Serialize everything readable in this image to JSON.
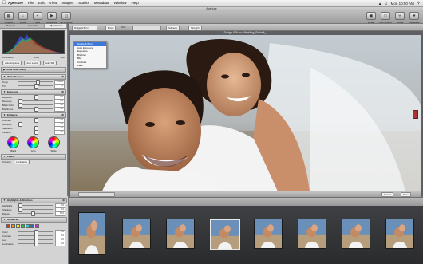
{
  "menubar": {
    "app": "Aperture",
    "items": [
      "File",
      "Edit",
      "View",
      "Images",
      "Stacks",
      "Metadata",
      "Window",
      "Help"
    ],
    "clock": "Mon 10:50 AM"
  },
  "window": {
    "title": "Aperture"
  },
  "toolbar": {
    "left": [
      {
        "label": "Projects",
        "icon": "projects-icon"
      },
      {
        "label": "Import",
        "icon": "import-icon"
      },
      {
        "label": "New",
        "icon": "new-icon"
      },
      {
        "label": "Slideshow",
        "icon": "slideshow-icon"
      },
      {
        "label": "All Projects",
        "icon": "all-projects-icon"
      }
    ],
    "right": [
      {
        "label": "Viewer",
        "icon": "viewer-icon"
      },
      {
        "label": "Full Screen",
        "icon": "fullscreen-icon"
      },
      {
        "label": "Loupe",
        "icon": "loupe-icon"
      },
      {
        "label": "Keywords",
        "icon": "keywords-icon"
      }
    ]
  },
  "inspector": {
    "tabs": [
      "Projects",
      "Metadata",
      "Adjustments"
    ],
    "histogram_labels": [
      "Luminance",
      "RGB",
      "Auto"
    ],
    "preset_buttons": [
      "Auto Exposure",
      "Auto Levels",
      "Auto WB"
    ],
    "sections": {
      "raw": "RAW Fine Tuning",
      "white_balance": "White Balance",
      "exposure": "Exposure",
      "enhance": "Enhance",
      "levels": "Levels",
      "highlights": "Highlights & Shadows",
      "advanced": "Advanced"
    },
    "sliders": [
      {
        "label": "Temp",
        "value": "5748 K",
        "pos": 0.55
      },
      {
        "label": "Tint",
        "value": "0",
        "pos": 0.5
      },
      {
        "label": "Exposure",
        "value": "0.0",
        "pos": 0.5
      },
      {
        "label": "Recovery",
        "value": "0.0",
        "pos": 0.05
      },
      {
        "label": "Black Point",
        "value": "0.0",
        "pos": 0.05
      },
      {
        "label": "Brightness",
        "value": "0.0",
        "pos": 0.5
      },
      {
        "label": "Contrast",
        "value": "0.0",
        "pos": 0.5
      },
      {
        "label": "Definition",
        "value": "0.0",
        "pos": 0.05
      },
      {
        "label": "Saturation",
        "value": "1.0",
        "pos": 0.5
      },
      {
        "label": "Vibrancy",
        "value": "0.0",
        "pos": 0.5
      }
    ],
    "wheels": [
      "Black",
      "Gray",
      "White"
    ],
    "levels_channel": "Luminance",
    "hs_sliders": [
      {
        "label": "Highlights",
        "value": "0.0",
        "pos": 0.05
      },
      {
        "label": "Shadows",
        "value": "0.0",
        "pos": 0.05
      },
      {
        "label": "Radius",
        "value": "50.0",
        "pos": 0.4
      },
      {
        "label": "Color",
        "value": "0.0",
        "pos": 0.5
      },
      {
        "label": "Contrast",
        "value": "0.0",
        "pos": 0.5
      },
      {
        "label": "Low",
        "value": "0.0",
        "pos": 0.5
      },
      {
        "label": "Luminance",
        "value": "0.0",
        "pos": 0.5
      }
    ]
  },
  "viewer": {
    "dropdown_current": "Dodge & Burn",
    "menu_options": [
      "Dodge & Burn",
      "Auto Exposure",
      "Exposure",
      "Brighten",
      "Blur",
      "Contrast",
      "Fade"
    ],
    "menu_selected": 0,
    "controls": [
      "Brush",
      "Size:",
      "Softness",
      "Strength"
    ],
    "image_title": "Dodge & Burn: Wedding_Portrait_1",
    "bottom_controls": [
      "Cancel",
      "Done"
    ]
  },
  "filmstrip": {
    "count": 8,
    "selected": 3
  }
}
